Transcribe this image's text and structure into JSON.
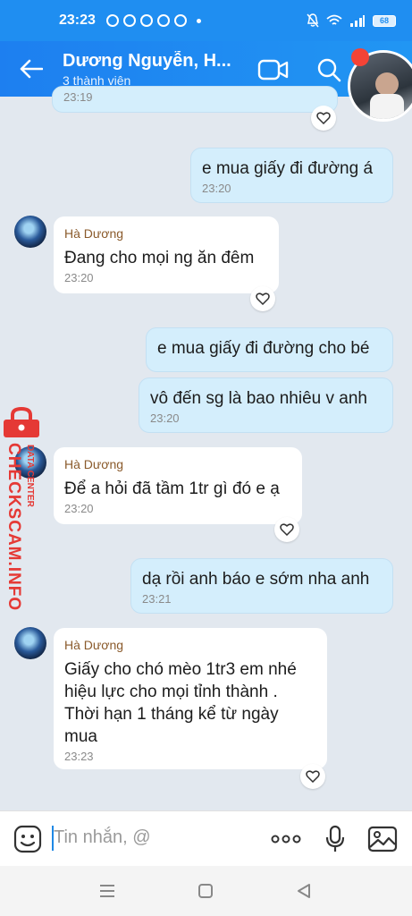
{
  "status_bar": {
    "time": "23:23",
    "battery": "68"
  },
  "header": {
    "title": "Dương Nguyễn, H...",
    "subtitle": "3 thành viên"
  },
  "messages": [
    {
      "direction": "out",
      "text": "",
      "time": "23:19"
    },
    {
      "direction": "out",
      "text": "e mua giấy đi đường á",
      "time": "23:20"
    },
    {
      "direction": "in",
      "sender": "Hà Dương",
      "text": "Đang cho mọi ng ăn đêm",
      "time": "23:20"
    },
    {
      "direction": "out",
      "text": "e mua giấy đi đường cho bé",
      "time": ""
    },
    {
      "direction": "out",
      "text": "vô đến sg là bao nhiêu v anh",
      "time": "23:20"
    },
    {
      "direction": "in",
      "sender": "Hà Dương",
      "text": "Để a hỏi đã tầm 1tr gì đó e ạ",
      "time": "23:20"
    },
    {
      "direction": "out",
      "text": "dạ rồi anh báo e sớm nha anh",
      "time": "23:21"
    },
    {
      "direction": "in",
      "sender": "Hà Dương",
      "text_lines": [
        "Giấy cho chó mèo 1tr3 em nhé",
        "hiệu lực cho mọi tỉnh thành .",
        "Thời hạn 1 tháng kể từ ngày",
        "mua"
      ],
      "time": "23:23"
    }
  ],
  "watermark": {
    "text": "CHECKSCAM.INFO",
    "sub": "DATA CENTER"
  },
  "input": {
    "placeholder": "Tin nhắn, @"
  },
  "icons": {
    "back": "arrow-left-icon",
    "video": "video-call-icon",
    "search": "search-icon",
    "emoji": "emoji-icon",
    "more": "more-dots-icon",
    "mic": "microphone-icon",
    "image": "image-icon",
    "heart": "heart-icon"
  },
  "colors": {
    "header": "#1f8ef1",
    "bubble_out": "#d4eefc",
    "bubble_in": "#ffffff",
    "sender_name": "#8a5a2b",
    "watermark": "#e53935"
  }
}
